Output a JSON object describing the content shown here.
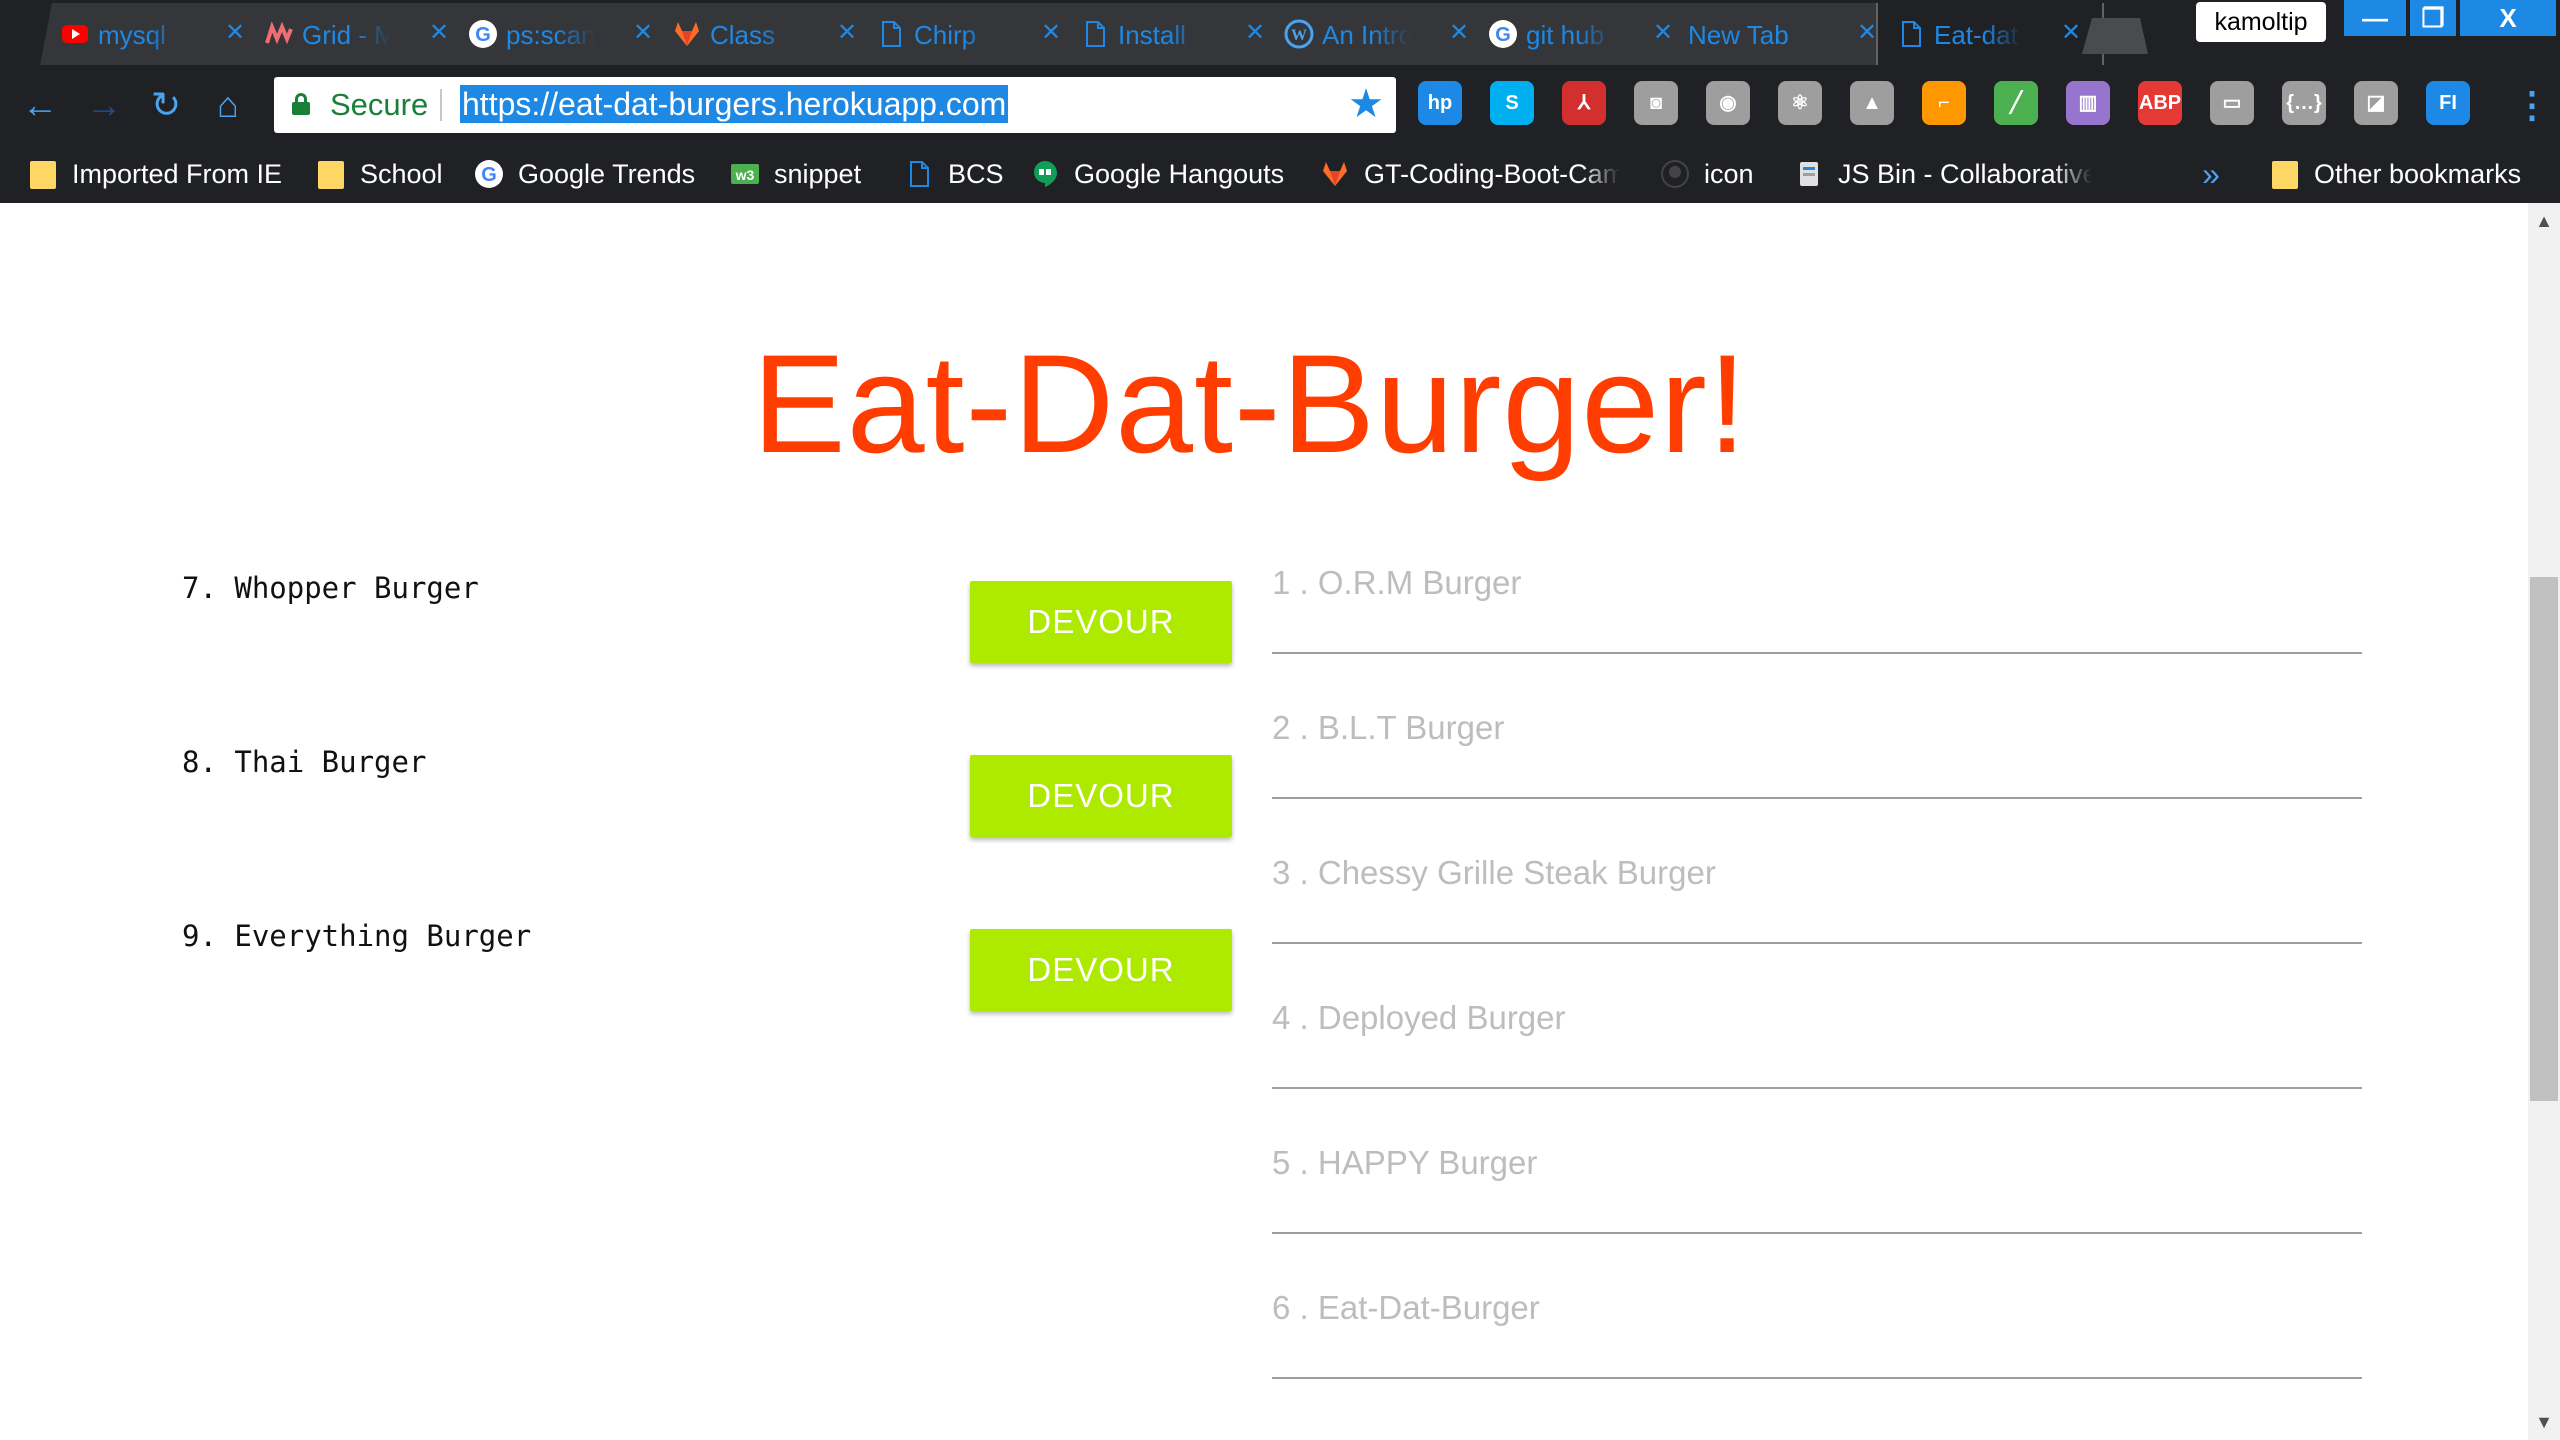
{
  "tabs": [
    {
      "title": "mysql",
      "favicon": "youtube-icon",
      "color": "#ff0000"
    },
    {
      "title": "Grid - Materialize",
      "favicon": "materialize-icon",
      "color": "#ee6e73"
    },
    {
      "title": "ps:scan",
      "favicon": "google-icon",
      "color": "#4285f4"
    },
    {
      "title": "Class",
      "favicon": "gitlab-icon",
      "color": "#fc6d26"
    },
    {
      "title": "Chirp",
      "favicon": "document-icon",
      "color": "#1e88e5"
    },
    {
      "title": "Install",
      "favicon": "document-icon",
      "color": "#1e88e5"
    },
    {
      "title": "An Intro",
      "favicon": "wordpress-icon",
      "color": "#1e88e5"
    },
    {
      "title": "git hub",
      "favicon": "google-icon",
      "color": "#4285f4"
    },
    {
      "title": "New Tab",
      "favicon": "",
      "color": ""
    },
    {
      "title": "Eat-dat",
      "favicon": "document-icon",
      "color": "#1e88e5",
      "active": true
    }
  ],
  "profile_name": "kamoltip",
  "window_controls": {
    "minimize": "—",
    "restore": "❐",
    "close": "X"
  },
  "omnibox": {
    "secure_label": "Secure",
    "url": "https://eat-dat-burgers.herokuapp.com"
  },
  "extensions": [
    {
      "name": "hp-icon",
      "label": "hp",
      "color": "#1e88e5"
    },
    {
      "name": "skype-icon",
      "label": "S",
      "color": "#00aff0"
    },
    {
      "name": "pdf-icon",
      "label": "⅄",
      "color": "#d32f2f"
    },
    {
      "name": "screenshot-icon",
      "label": "◙",
      "color": "#9e9e9e"
    },
    {
      "name": "eye-icon",
      "label": "◉",
      "color": "#9e9e9e"
    },
    {
      "name": "react-icon",
      "label": "⚛",
      "color": "#9e9e9e"
    },
    {
      "name": "drive-icon",
      "label": "▲",
      "color": "#9e9e9e"
    },
    {
      "name": "ruler-icon",
      "label": "⌐",
      "color": "#ff9800"
    },
    {
      "name": "pen-icon",
      "label": "╱",
      "color": "#4caf50"
    },
    {
      "name": "grid-icon",
      "label": "▥",
      "color": "#9575cd"
    },
    {
      "name": "adblock-icon",
      "label": "ABP",
      "color": "#e53935"
    },
    {
      "name": "capture-icon",
      "label": "▭",
      "color": "#9e9e9e"
    },
    {
      "name": "json-icon",
      "label": "{…}",
      "color": "#9e9e9e"
    },
    {
      "name": "window-icon",
      "label": "◪",
      "color": "#9e9e9e"
    },
    {
      "name": "fi-icon",
      "label": "FI",
      "color": "#1e88e5"
    }
  ],
  "bookmarks": [
    {
      "label": "Imported From IE",
      "icon": "folder-icon"
    },
    {
      "label": "School",
      "icon": "folder-icon"
    },
    {
      "label": "Google Trends",
      "icon": "google-icon"
    },
    {
      "label": "snippet",
      "icon": "w3-icon"
    },
    {
      "label": "BCS",
      "icon": "document-icon"
    },
    {
      "label": "Google Hangouts",
      "icon": "hangouts-icon"
    },
    {
      "label": "GT-Coding-Boot-Cam",
      "icon": "gitlab-icon"
    },
    {
      "label": "icon",
      "icon": "github-icon"
    },
    {
      "label": "JS Bin - Collaborative",
      "icon": "jsbin-icon"
    }
  ],
  "bookmarks_more": "»",
  "other_bookmarks": "Other bookmarks",
  "page": {
    "title": "Eat-Dat-Burger!",
    "devour_label": "DEVOUR",
    "uneaten": [
      "7. Whopper Burger",
      "8. Thai Burger",
      "9. Everything Burger"
    ],
    "devoured": [
      "1 . O.R.M Burger",
      "2 . B.L.T Burger",
      "3 . Chessy Grille Steak Burger",
      "4 . Deployed Burger",
      "5 . HAPPY Burger",
      "6 . Eat-Dat-Burger"
    ]
  },
  "colors": {
    "title": "#ff3d00",
    "devour_button": "#aeea00",
    "devoured_text": "#bdbdbd",
    "chrome_dark": "#202124",
    "accent": "#1e88e5"
  }
}
